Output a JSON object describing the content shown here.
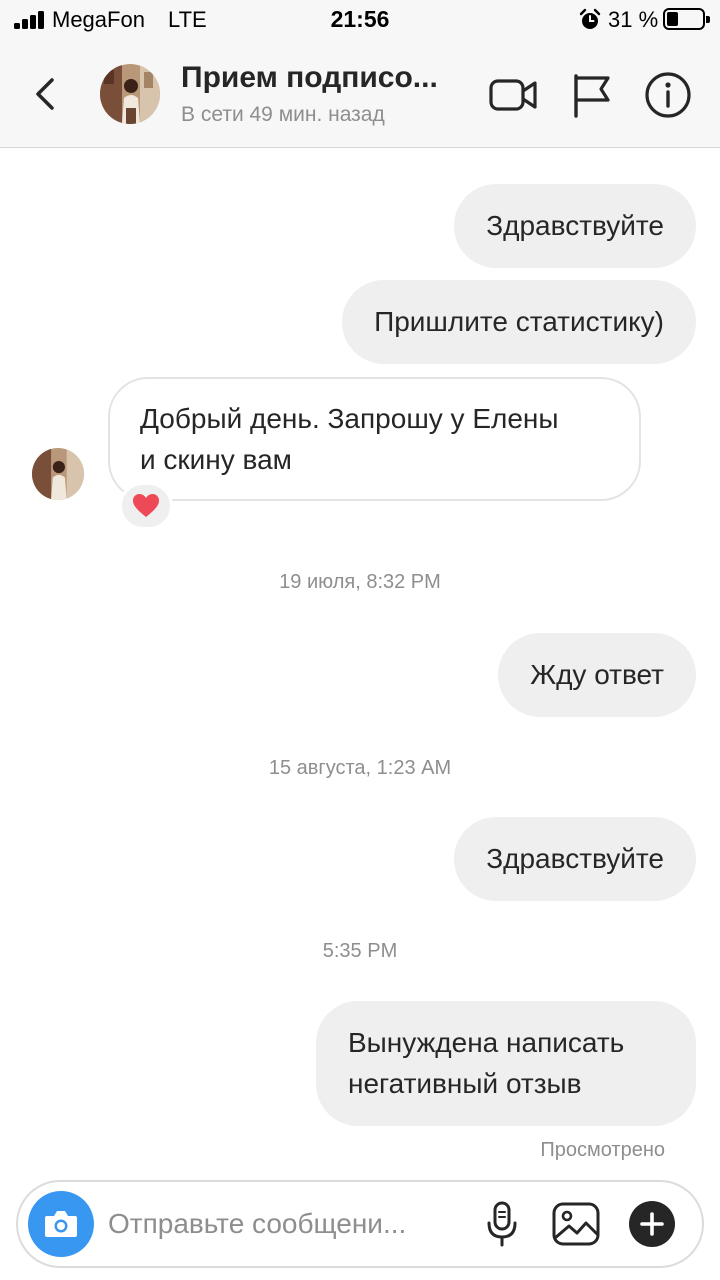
{
  "status_bar": {
    "carrier": "MegaFon",
    "network": "LTE",
    "time": "21:56",
    "battery": "31 %",
    "battery_level": 0.31,
    "icons": [
      "signal-icon",
      "alarm-icon",
      "battery-icon"
    ]
  },
  "header": {
    "title": "Прием подписо...",
    "subtitle": "В сети 49 мин. назад",
    "icons": [
      "back-chevron-icon",
      "video-camera-icon",
      "flag-icon",
      "info-icon"
    ]
  },
  "messages": [
    {
      "direction": "outgoing",
      "text": "Здравствуйте"
    },
    {
      "direction": "outgoing",
      "text": "Пришлите статистику)"
    },
    {
      "direction": "incoming",
      "lines": [
        "Добрый день. Запрошу у Елены",
        "и скину вам"
      ],
      "reaction": "heart-icon"
    },
    {
      "direction": "outgoing",
      "text": "Жду ответ"
    },
    {
      "direction": "outgoing",
      "text": "Здравствуйте"
    },
    {
      "direction": "outgoing",
      "lines": [
        "Вынуждена написать",
        "негативный отзыв"
      ]
    }
  ],
  "timestamps": [
    "19 июля, 8:32 PM",
    "15 августа, 1:23 AM",
    "5:35 PM"
  ],
  "seen_label": "Просмотрено",
  "composer": {
    "placeholder": "Отправьте сообщени...",
    "icons": [
      "camera-icon",
      "microphone-icon",
      "gallery-icon",
      "plus-icon"
    ]
  },
  "colors": {
    "accent": "#3897f0",
    "bubble_outgoing": "#efefef",
    "secondary_text": "#8e8e8e",
    "heart": "#ed4956"
  }
}
